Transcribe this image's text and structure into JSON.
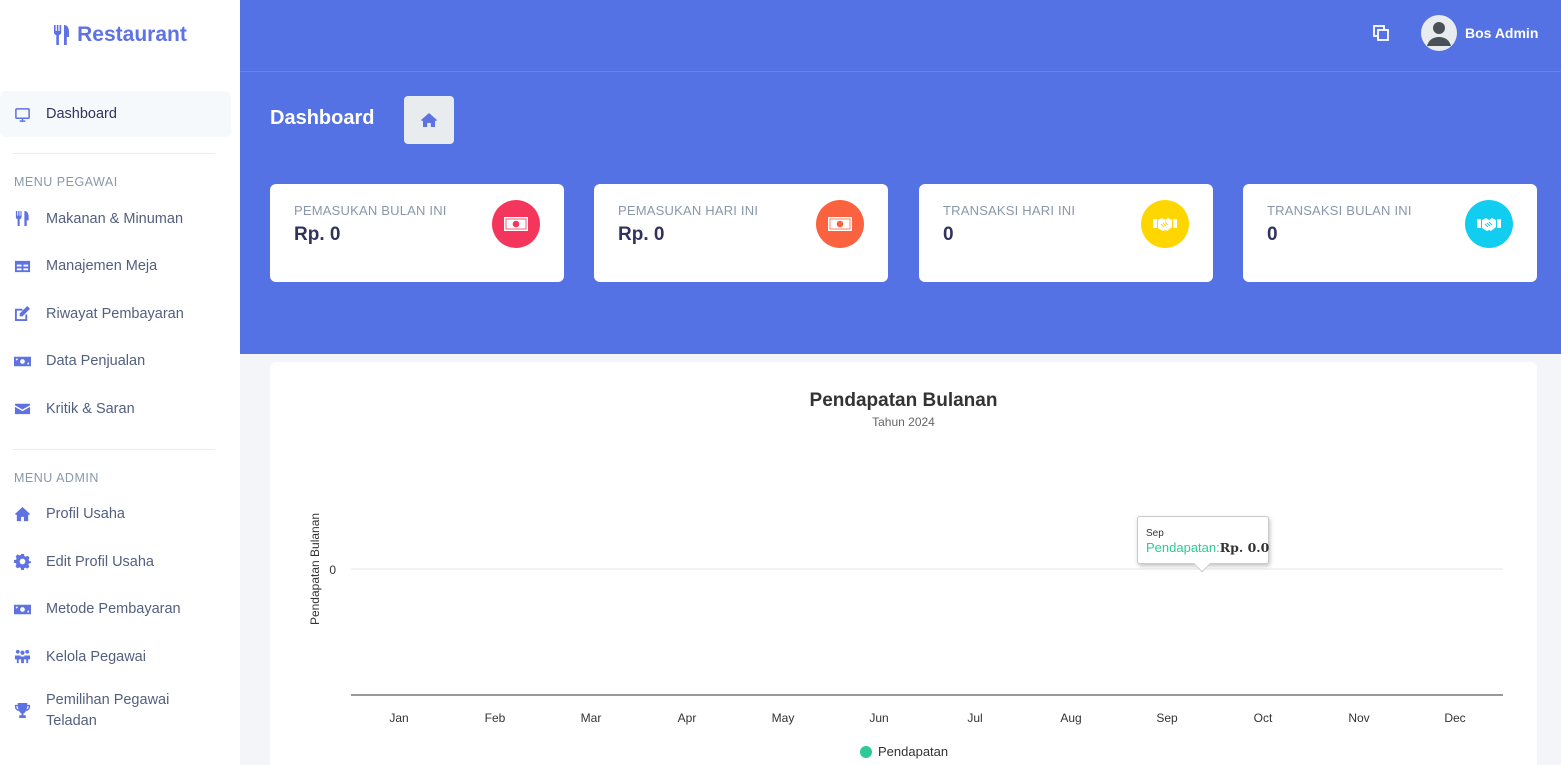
{
  "brand": {
    "name": "Restaurant",
    "icon": "utensils-icon"
  },
  "sidebar": {
    "dashboard": "Dashboard",
    "menu_pegawai_head": "MENU PEGAWAI",
    "pegawai_items": [
      {
        "label": "Makanan & Minuman",
        "icon": "utensils-icon"
      },
      {
        "label": "Manajemen Meja",
        "icon": "table-icon"
      },
      {
        "label": "Riwayat Pembayaran",
        "icon": "edit-icon"
      },
      {
        "label": "Data Penjualan",
        "icon": "money-bill-icon"
      },
      {
        "label": "Kritik & Saran",
        "icon": "envelope-icon"
      }
    ],
    "menu_admin_head": "MENU ADMIN",
    "admin_items": [
      {
        "label": "Profil Usaha",
        "icon": "home-icon"
      },
      {
        "label": "Edit Profil Usaha",
        "icon": "cog-icon"
      },
      {
        "label": "Metode Pembayaran",
        "icon": "money-bill-icon"
      },
      {
        "label": "Kelola Pegawai",
        "icon": "users-icon"
      },
      {
        "label_line1": "Pemilihan Pegawai",
        "label_line2": "Teladan",
        "icon": "trophy-icon"
      }
    ]
  },
  "header": {
    "user_name": "Bos Admin",
    "page_title": "Dashboard"
  },
  "stats": [
    {
      "label": "PEMASUKAN BULAN INI",
      "value": "Rp. 0",
      "color": "#f5365c",
      "icon": "money-bill-icon"
    },
    {
      "label": "PEMASUKAN HARI INI",
      "value": "Rp. 0",
      "color": "#fb6340",
      "icon": "money-bill-icon"
    },
    {
      "label": "TRANSAKSI HARI INI",
      "value": "0",
      "color": "#ffd600",
      "icon": "handshake-icon"
    },
    {
      "label": "TRANSAKSI BULAN INI",
      "value": "0",
      "color": "#11cdef",
      "icon": "handshake-icon"
    }
  ],
  "chart": {
    "tooltip": {
      "x": "Sep",
      "name": "Pendapatan:",
      "value": "Rp. 0.0"
    },
    "legend": "Pendapatan"
  },
  "chart_data": {
    "type": "line",
    "title": "Pendapatan Bulanan",
    "subtitle": "Tahun 2024",
    "xlabel": "",
    "ylabel": "Pendapatan Bulanan",
    "categories": [
      "Jan",
      "Feb",
      "Mar",
      "Apr",
      "May",
      "Jun",
      "Jul",
      "Aug",
      "Sep",
      "Oct",
      "Nov",
      "Dec"
    ],
    "y_ticks": [
      "0"
    ],
    "series": [
      {
        "name": "Pendapatan",
        "color": "#2ec998",
        "values": [
          0,
          0,
          0,
          0,
          0,
          0,
          0,
          0,
          0,
          0,
          0,
          0
        ]
      }
    ],
    "legend_position": "bottom-center",
    "grid": true
  }
}
